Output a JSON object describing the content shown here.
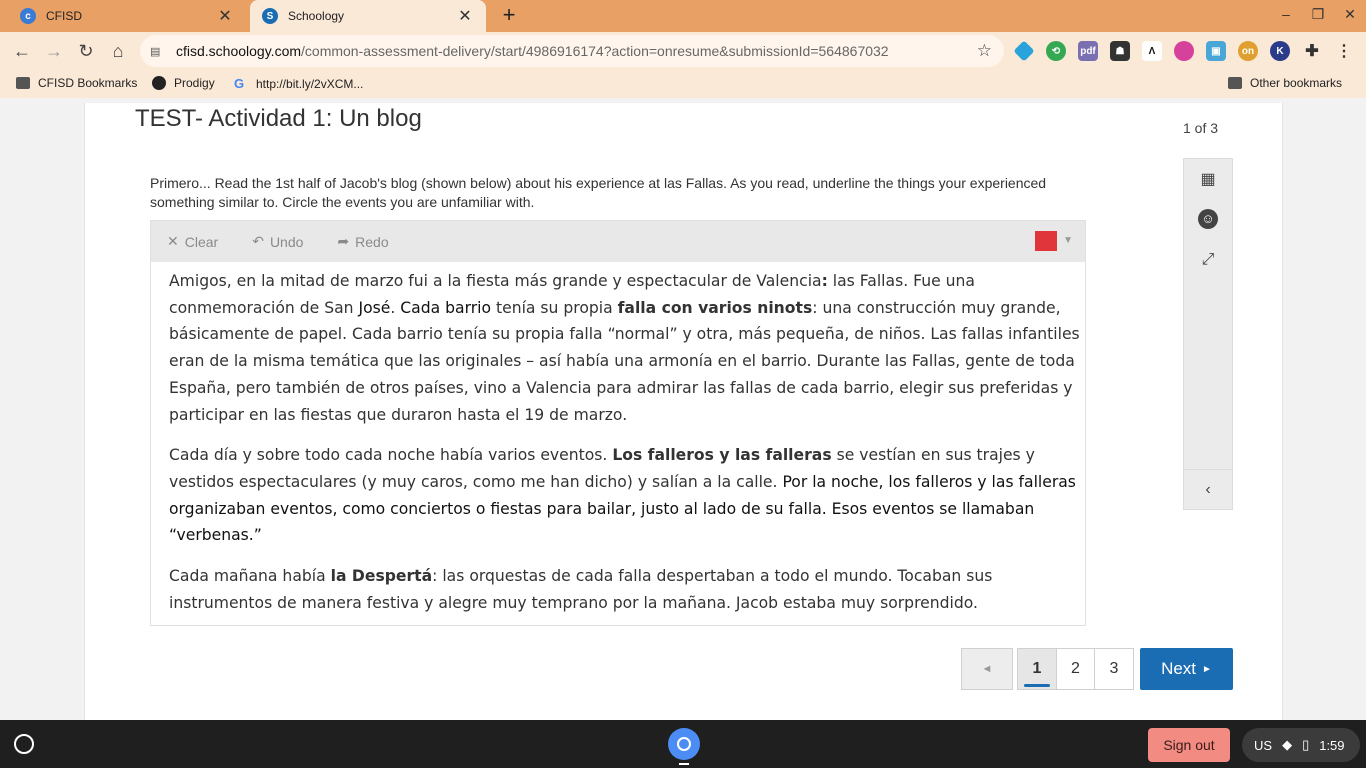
{
  "browser": {
    "tabs": [
      {
        "title": "CFISD",
        "active": false
      },
      {
        "title": "Schoology",
        "active": true
      }
    ],
    "url_host": "cfisd.schoology.com",
    "url_path": "/common-assessment-delivery/start/4986916174?action=onresume&submissionId=564867032",
    "bookmarks": [
      "CFISD Bookmarks",
      "Prodigy",
      "http://bit.ly/2vXCM...",
      "Other bookmarks"
    ],
    "accent": "#e8a064"
  },
  "assessment": {
    "title": "TEST- Actividad 1: Un blog",
    "counter": "1 of 3",
    "instructions": "Primero... Read the 1st half of Jacob's blog (shown below) about his experience at las Fallas.  As you read, underline the things your experienced something similar to.  Circle the events you are unfamiliar with.",
    "toolbar": {
      "clear": "Clear",
      "undo": "Undo",
      "redo": "Redo",
      "pen_color": "#e0353a"
    },
    "blog": {
      "p1_a": "Amigos, en la mitad de marzo fui a la fiesta más grande y espectacular de Valencia",
      "p1_colon": ":",
      "p1_b": " las Fallas.  Fue una conmemoración de San ",
      "p1_jose": "José",
      "p1_c": ".  ",
      "p1_cada": "Cada barrio",
      "p1_d": " tenía su propia ",
      "p1_falla": "falla con varios ninots",
      "p1_e": ": una construcción muy grande, básicamente de papel.  Cada barrio tenía su propia falla “normal” y otra, más pequeña, de niños. Las fallas infantiles eran de la misma temática que las originales – así había una armonía en el barrio. Durante las Fallas, gente de toda España, pero también de otros países, vino a Valencia para admirar las fallas de cada barrio, elegir sus preferidas y participar en las fiestas que duraron hasta el 19 de marzo.",
      "p2_a": "Cada día y sobre todo cada noche había varios eventos. ",
      "p2_bold": "Los falleros y las falleras",
      "p2_b": " se vestían en sus trajes y vestidos espectaculares (y muy caros, como me han dicho) y salían a la calle. ",
      "p2_c": "Por la noche, los falleros y las falleras organizaban eventos, como conciertos o fiestas para bailar, justo al lado de su falla. Esos eventos se llamaban “verbenas.”",
      "p3_a": "Cada mañana había ",
      "p3_bold": "la Despertá",
      "p3_b": ": las orquestas de cada falla despertaban a todo el mundo.  Tocaban sus instrumentos de manera festiva y alegre muy temprano por la mañana.  Jacob estaba muy sorprendido."
    },
    "pagination": {
      "pages": [
        "1",
        "2",
        "3"
      ],
      "current": "1",
      "next": "Next"
    }
  },
  "shelf": {
    "signout": "Sign out",
    "locale": "US",
    "time": "1:59"
  }
}
